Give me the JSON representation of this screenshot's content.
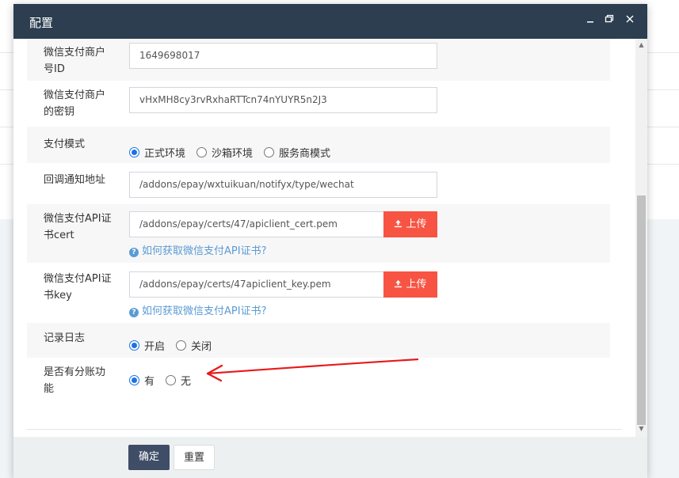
{
  "modal": {
    "title": "配置",
    "minimize_icon": "minimize-icon",
    "maximize_icon": "maximize-icon",
    "close_icon": "close-icon"
  },
  "form": {
    "merchant_id": {
      "label_line1": "微信支付商户",
      "label_line2": "号ID",
      "value": "1649698017"
    },
    "merchant_key": {
      "label_line1": "微信支付商户",
      "label_line2": "的密钥",
      "value": "vHxMH8cy3rvRxhaRTTcn74nYUYR5n2J3"
    },
    "pay_mode": {
      "label": "支付模式",
      "options": [
        "正式环境",
        "沙箱环境",
        "服务商模式"
      ],
      "selected": "正式环境"
    },
    "notify_url": {
      "label": "回调通知地址",
      "value": "/addons/epay/wxtuikuan/notifyx/type/wechat"
    },
    "cert": {
      "label_line1": "微信支付API证",
      "label_line2": "书cert",
      "value": "/addons/epay/certs/47/apiclient_cert.pem",
      "upload_label": "上传",
      "help_text": "如何获取微信支付API证书?"
    },
    "key": {
      "label_line1": "微信支付API证",
      "label_line2": "书key",
      "value": "/addons/epay/certs/47apiclient_key.pem",
      "upload_label": "上传",
      "help_text": "如何获取微信支付API证书?"
    },
    "log": {
      "label": "记录日志",
      "options": [
        "开启",
        "关闭"
      ],
      "selected": "开启"
    },
    "split": {
      "label_line1": "是否有分账功",
      "label_line2": "能",
      "options": [
        "有",
        "无"
      ],
      "selected": "有"
    }
  },
  "footer": {
    "confirm_label": "确定",
    "reset_label": "重置"
  },
  "colors": {
    "header_bg": "#2c3e50",
    "upload_btn": "#f75444",
    "primary_btn": "#3f4d67",
    "link": "#5b9bd5",
    "radio_checked": "#1a73e8",
    "arrow": "#e8191a"
  }
}
